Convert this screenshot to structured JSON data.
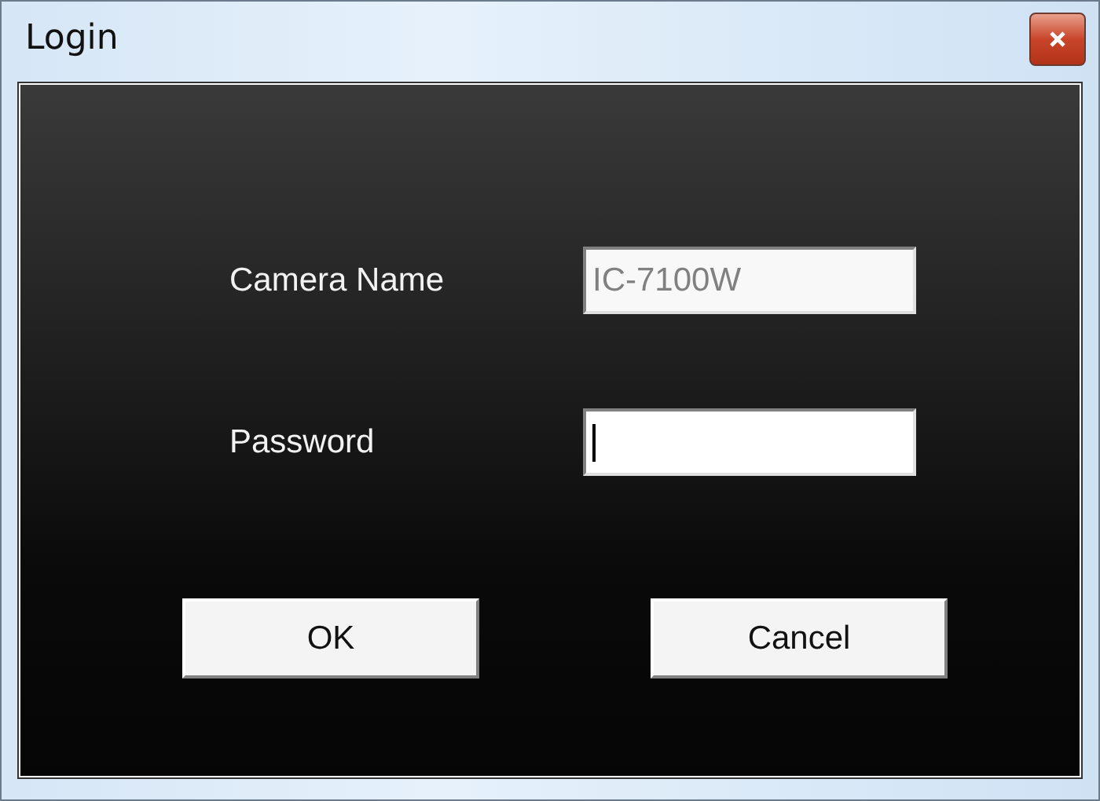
{
  "window": {
    "title": "Login"
  },
  "fields": [
    {
      "label": "Camera Name",
      "value": "IC-7100W",
      "disabled": true,
      "focused": false
    },
    {
      "label": "Password",
      "disabled": false,
      "focused": true
    }
  ],
  "buttons": [
    "OK",
    "Cancel"
  ]
}
